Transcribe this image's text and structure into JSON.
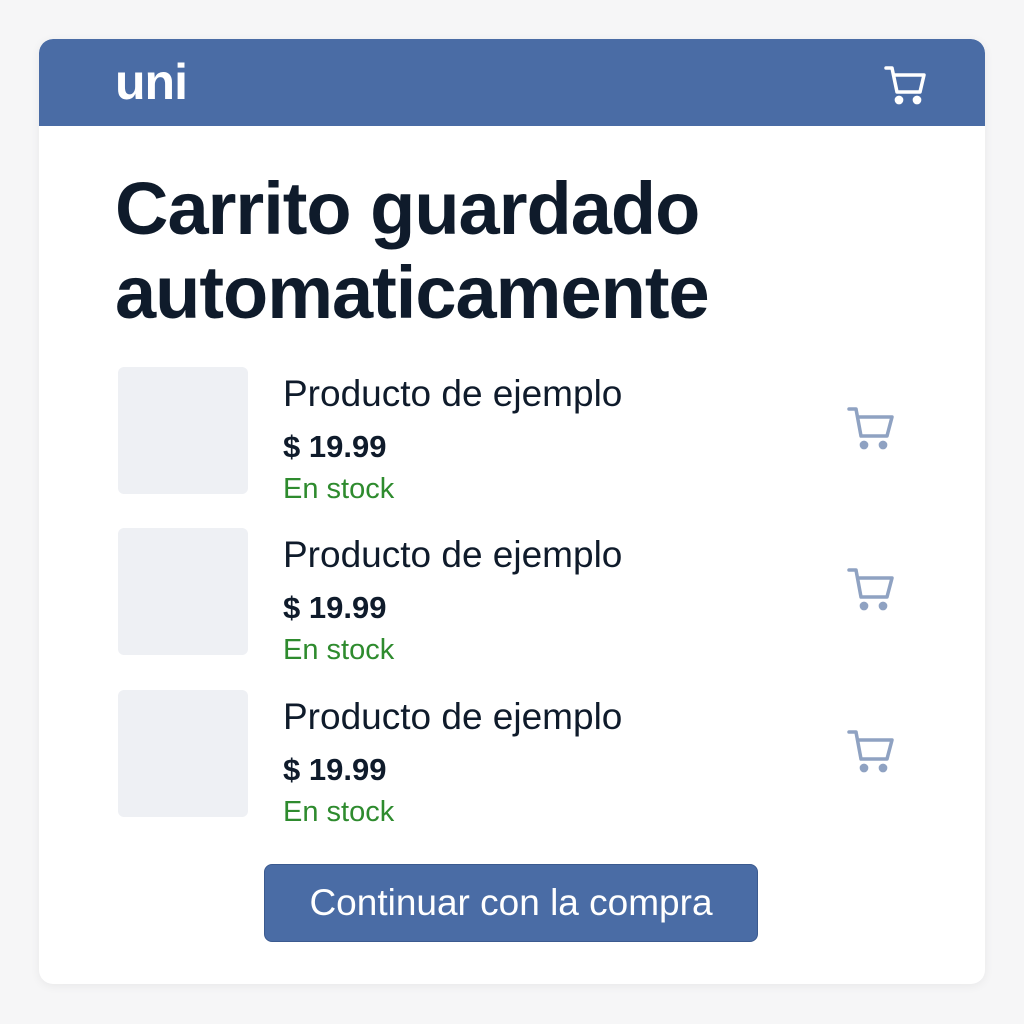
{
  "header": {
    "brand": "uni",
    "cart_icon": "shopping-cart-icon"
  },
  "main": {
    "title": "Carrito guardado automaticamente",
    "items": [
      {
        "name": "Producto de ejemplo",
        "price": "$ 19.99",
        "stock": "En stock",
        "icon": "add-to-cart-icon"
      },
      {
        "name": "Producto de ejemplo",
        "price": "$ 19.99",
        "stock": "En stock",
        "icon": "add-to-cart-icon"
      },
      {
        "name": "Producto de ejemplo",
        "price": "$ 19.99",
        "stock": "En stock",
        "icon": "add-to-cart-icon"
      }
    ],
    "cta_label": "Continuar con la compra"
  },
  "colors": {
    "header_bg": "#4a6ca5",
    "stock_green": "#2e8b2e",
    "title_text": "#0f1b2b",
    "icon_muted": "#8fa2c2"
  }
}
